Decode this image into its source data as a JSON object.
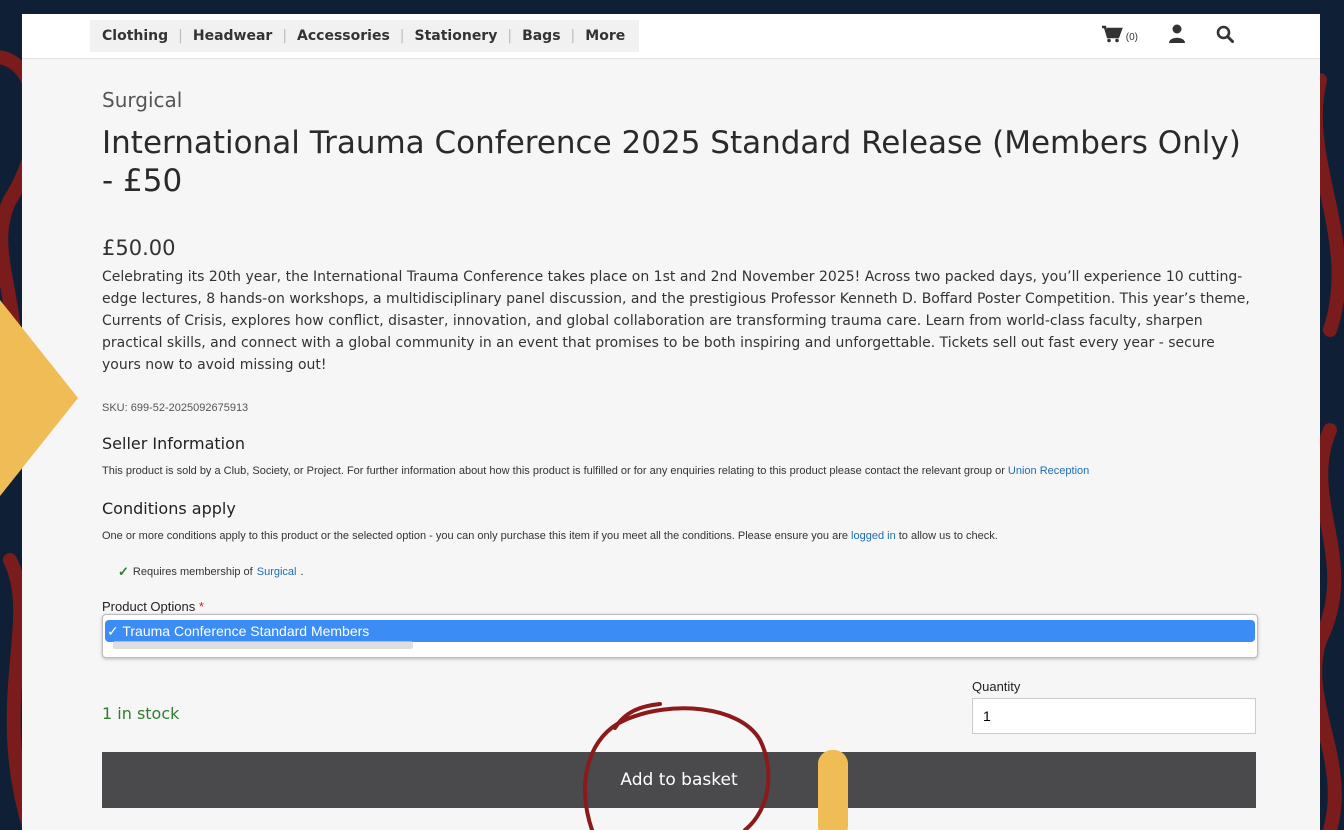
{
  "nav": {
    "menu_items": [
      "Clothing",
      "Headwear",
      "Accessories",
      "Stationery",
      "Bags",
      "More"
    ],
    "cart_count": "(0)"
  },
  "product": {
    "category": "Surgical",
    "title": "International Trauma Conference 2025 Standard Release (Members Only) - £50",
    "price": "£50.00",
    "description": "Celebrating its 20th year, the International Trauma Conference takes place on 1st and 2nd November 2025! Across two packed days, you’ll experience 10 cutting-edge lectures, 8 hands-on workshops, a multidisciplinary panel discussion, and the prestigious Professor Kenneth D. Boffard Poster Competition. This year’s theme, Currents of Crisis, explores how conflict, disaster, innovation, and global collaboration are transforming trauma care. Learn from world-class faculty, sharpen practical skills, and connect with a global community in an event that promises to be both inspiring and unforgettable. Tickets sell out fast every year - secure yours now to avoid missing out!",
    "sku": "SKU: 699-52-2025092675913"
  },
  "seller": {
    "heading": "Seller Information",
    "text": "This product is sold by a Club, Society, or Project. For further information about how this product is fulfilled or for any enquiries relating to this product please contact the relevant group or ",
    "link": "Union Reception"
  },
  "conditions": {
    "heading": "Conditions apply",
    "text_before": "One or more conditions apply to this product or the selected option - you can only purchase this item if you meet all the conditions. Please ensure you are ",
    "login_link": "logged in",
    "text_after": " to allow us to check.",
    "requirement_text": "Requires membership of ",
    "requirement_link": "Surgical",
    "requirement_end": "."
  },
  "options": {
    "label": "Product Options",
    "required_mark": "*",
    "selected": "✓ Trauma Conference Standard Members"
  },
  "purchase": {
    "stock": "1 in stock",
    "quantity_label": "Quantity",
    "quantity_value": "1",
    "add_button": "Add to basket"
  },
  "colors": {
    "background": "#0e1f36",
    "accent_red": "#8b1a1a",
    "arrow_yellow": "#f0bc55",
    "select_blue": "#3b8cf5",
    "button_dark": "#4a4a4c",
    "stock_green": "#2e7d32",
    "link_blue": "#1e6db5"
  },
  "icons": [
    "cart-icon",
    "user-icon",
    "search-icon",
    "checkmark-icon"
  ]
}
